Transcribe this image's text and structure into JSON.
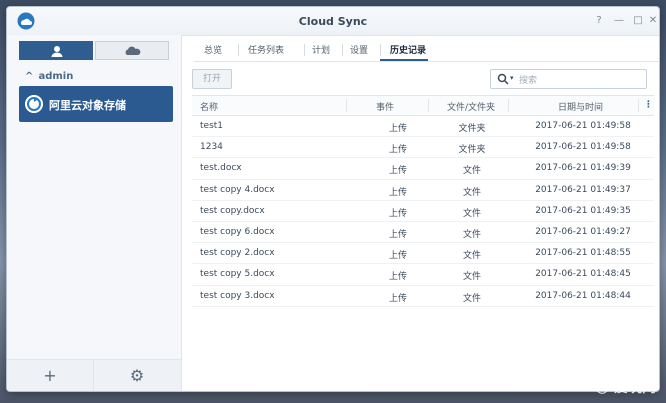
{
  "window": {
    "title": "Cloud Sync"
  },
  "sidebar": {
    "user": "admin",
    "provider_label": "阿里云对象存储"
  },
  "tabs": [
    {
      "label": "总览"
    },
    {
      "label": "任务列表"
    },
    {
      "label": "计划"
    },
    {
      "label": "设置"
    },
    {
      "label": "历史记录"
    }
  ],
  "toolbar": {
    "open_label": "打开",
    "search_placeholder": "搜索"
  },
  "table": {
    "headers": [
      "名称",
      "事件",
      "文件/文件夹",
      "日期与时间"
    ],
    "rows": [
      {
        "name": "test1",
        "event": "上传",
        "type": "文件夹",
        "time": "2017-06-21 01:49:58"
      },
      {
        "name": "1234",
        "event": "上传",
        "type": "文件夹",
        "time": "2017-06-21 01:49:58"
      },
      {
        "name": "test.docx",
        "event": "上传",
        "type": "文件",
        "time": "2017-06-21 01:49:39"
      },
      {
        "name": "test copy 4.docx",
        "event": "上传",
        "type": "文件",
        "time": "2017-06-21 01:49:37"
      },
      {
        "name": "test copy.docx",
        "event": "上传",
        "type": "文件",
        "time": "2017-06-21 01:49:35"
      },
      {
        "name": "test copy 6.docx",
        "event": "上传",
        "type": "文件",
        "time": "2017-06-21 01:49:27"
      },
      {
        "name": "test copy 2.docx",
        "event": "上传",
        "type": "文件",
        "time": "2017-06-21 01:48:55"
      },
      {
        "name": "test copy 5.docx",
        "event": "上传",
        "type": "文件",
        "time": "2017-06-21 01:48:45"
      },
      {
        "name": "test copy 3.docx",
        "event": "上传",
        "type": "文件",
        "time": "2017-06-21 01:48:44"
      }
    ]
  },
  "watermark": "爱玩网"
}
